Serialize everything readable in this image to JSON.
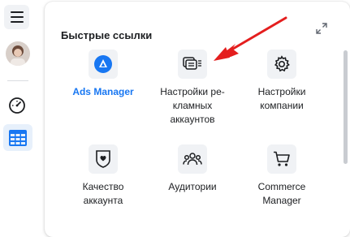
{
  "panel": {
    "title": "Быстрые ссылки"
  },
  "tiles": [
    {
      "label": "Ads Manager",
      "icon": "ads-manager-icon"
    },
    {
      "label": "Настройки ре-кламных аккаунтов",
      "icon": "ad-accounts-settings-icon"
    },
    {
      "label": "Настройки компании",
      "icon": "gear-icon"
    },
    {
      "label": "Качество аккаунта",
      "icon": "shield-icon"
    },
    {
      "label": "Аудитории",
      "icon": "people-icon"
    },
    {
      "label": "Commerce Manager",
      "icon": "cart-icon"
    }
  ],
  "colors": {
    "accent": "#1877f2",
    "arrow": "#e41e1e",
    "icon_bg": "#f0f2f5",
    "active_rail_bg": "#e7f0fb"
  }
}
